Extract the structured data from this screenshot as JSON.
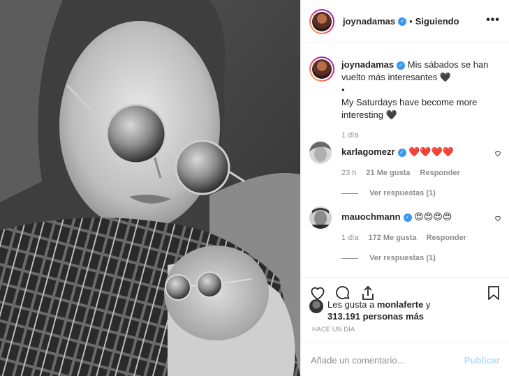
{
  "post": {
    "username": "joynadamas",
    "separator": "•",
    "following_label": "Siguiendo",
    "more_label": "•••"
  },
  "caption": {
    "username": "joynadamas",
    "text_es": "Mis sábados se han vuelto más interesantes 🖤",
    "bullet": "•",
    "text_en": "My Saturdays have become more interesting 🖤",
    "time": "1 día"
  },
  "comments": [
    {
      "username": "karlagomezr",
      "text": "❤️❤️❤️❤️",
      "time": "23 h",
      "likes": "21 Me gusta",
      "reply": "Responder",
      "view_replies": "Ver respuestas (1)"
    },
    {
      "username": "mauochmann",
      "text": "😍😍😍😍",
      "time": "1 día",
      "likes": "172 Me gusta",
      "reply": "Responder",
      "view_replies": "Ver respuestas (1)"
    }
  ],
  "likes": {
    "prefix": "Les gusta a",
    "user": "monlaferte",
    "connector": "y",
    "others": "313.191 personas más"
  },
  "time_ago": "HACE UN DÍA",
  "composer": {
    "placeholder": "Añade un comentario...",
    "publish_label": "Publicar"
  },
  "icons": {
    "like": "heart-icon",
    "comment": "comment-icon",
    "share": "share-icon",
    "save": "bookmark-icon",
    "more": "more-options-icon",
    "verified": "verified-badge-icon"
  },
  "colors": {
    "verified": "#3897f0",
    "publish_disabled": "#b2dffc",
    "muted_text": "#8e8e8e"
  }
}
